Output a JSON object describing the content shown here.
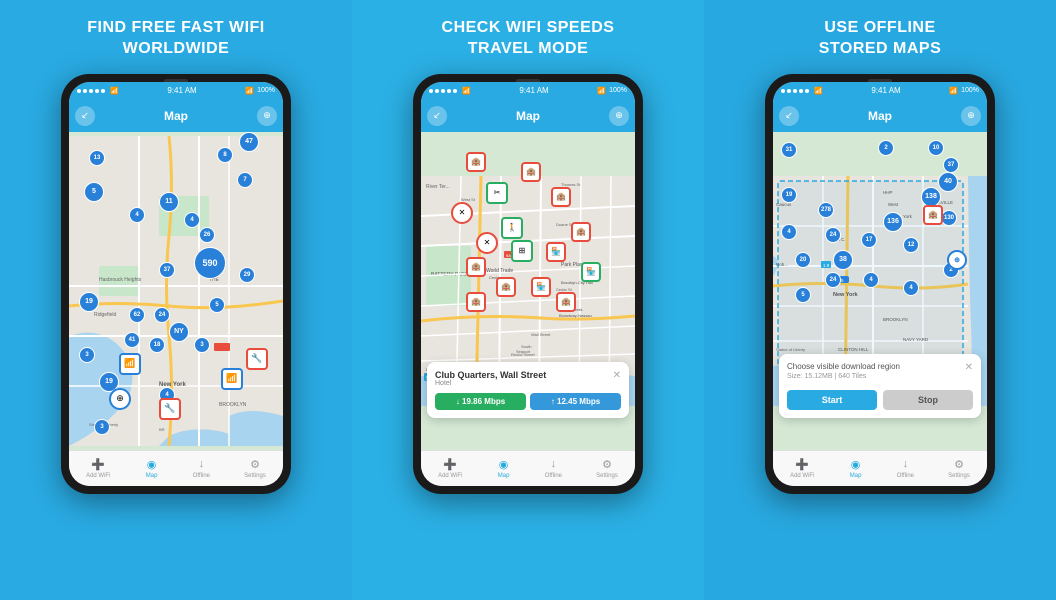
{
  "panels": [
    {
      "id": "panel-1",
      "title": "FIND FREE FAST WIFI\nWORLDWIDE",
      "color": "#29aae2"
    },
    {
      "id": "panel-2",
      "title": "CHECK WIFI SPEEDS\nTRAVEL MODE",
      "color": "#2bb0e5"
    },
    {
      "id": "panel-3",
      "title": "USE OFFLINE\nSTORED MAPS",
      "color": "#28a8e0"
    }
  ],
  "phone": {
    "status_time": "9:41 AM",
    "status_battery": "100%",
    "app_bar_title": "Map"
  },
  "popup": {
    "title": "Club Quarters, Wall Street",
    "subtitle": "Hotel",
    "close": "✕",
    "speed_down": "↓ 19.86 Mbps",
    "speed_up": "↑ 12.45 Mbps"
  },
  "download_popup": {
    "title": "Choose visible download region",
    "subtitle": "Size: 15.12MB | 640 Tiles",
    "close": "✕",
    "start_label": "Start",
    "stop_label": "Stop"
  },
  "nav": {
    "items": [
      {
        "icon": "➕",
        "label": "Add WiFi"
      },
      {
        "icon": "◉",
        "label": "Map",
        "active": true
      },
      {
        "icon": "↓",
        "label": "Offline"
      },
      {
        "icon": "⚙",
        "label": "Settings"
      }
    ]
  }
}
